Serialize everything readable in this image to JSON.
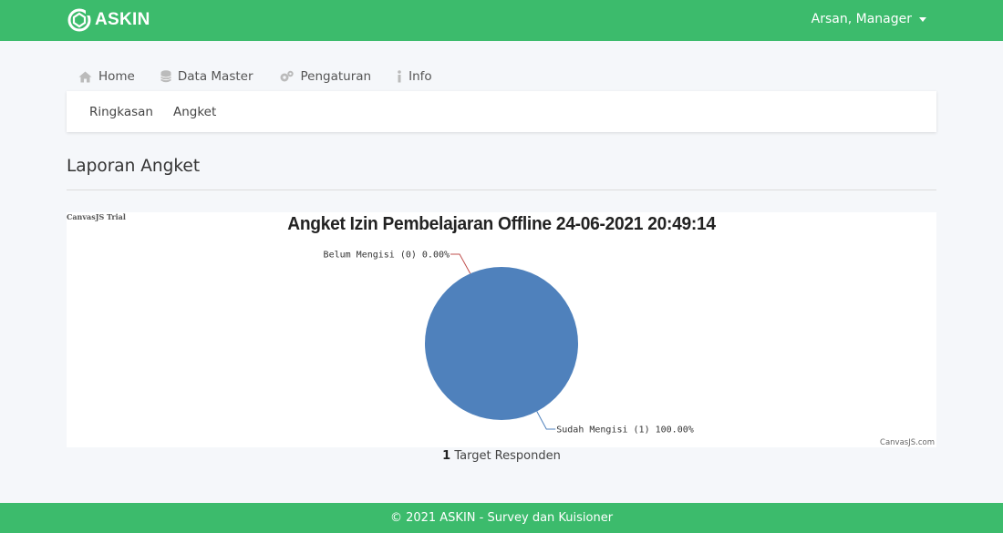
{
  "brand": {
    "name": "ASKIN"
  },
  "user": {
    "label": "Arsan, Manager"
  },
  "nav": [
    {
      "label": "Home",
      "icon": "home-icon"
    },
    {
      "label": "Data Master",
      "icon": "database-icon"
    },
    {
      "label": "Pengaturan",
      "icon": "gears-icon"
    },
    {
      "label": "Info",
      "icon": "info-icon"
    }
  ],
  "subnav": [
    {
      "label": "Ringkasan"
    },
    {
      "label": "Angket"
    }
  ],
  "page": {
    "title": "Laporan Angket"
  },
  "chart": {
    "trial_label": "CanvasJS Trial",
    "credit": "CanvasJS.com"
  },
  "chart_data": {
    "type": "pie",
    "title": "Angket Izin Pembelajaran Offline 24-06-2021 20:49:14",
    "slices": [
      {
        "label": "Belum Mengisi",
        "value": 0,
        "percent": "0.00%",
        "display": "Belum Mengisi (0) 0.00%",
        "color": "#c0504e"
      },
      {
        "label": "Sudah Mengisi",
        "value": 1,
        "percent": "100.00%",
        "display": "Sudah Mengisi (1) 100.00%",
        "color": "#4f81bc"
      }
    ]
  },
  "summary": {
    "count": "1",
    "text": " Target Responden"
  },
  "footer": {
    "text": "© 2021 ASKIN - Survey dan Kuisioner"
  },
  "colors": {
    "brand": "#3cbb6c"
  }
}
